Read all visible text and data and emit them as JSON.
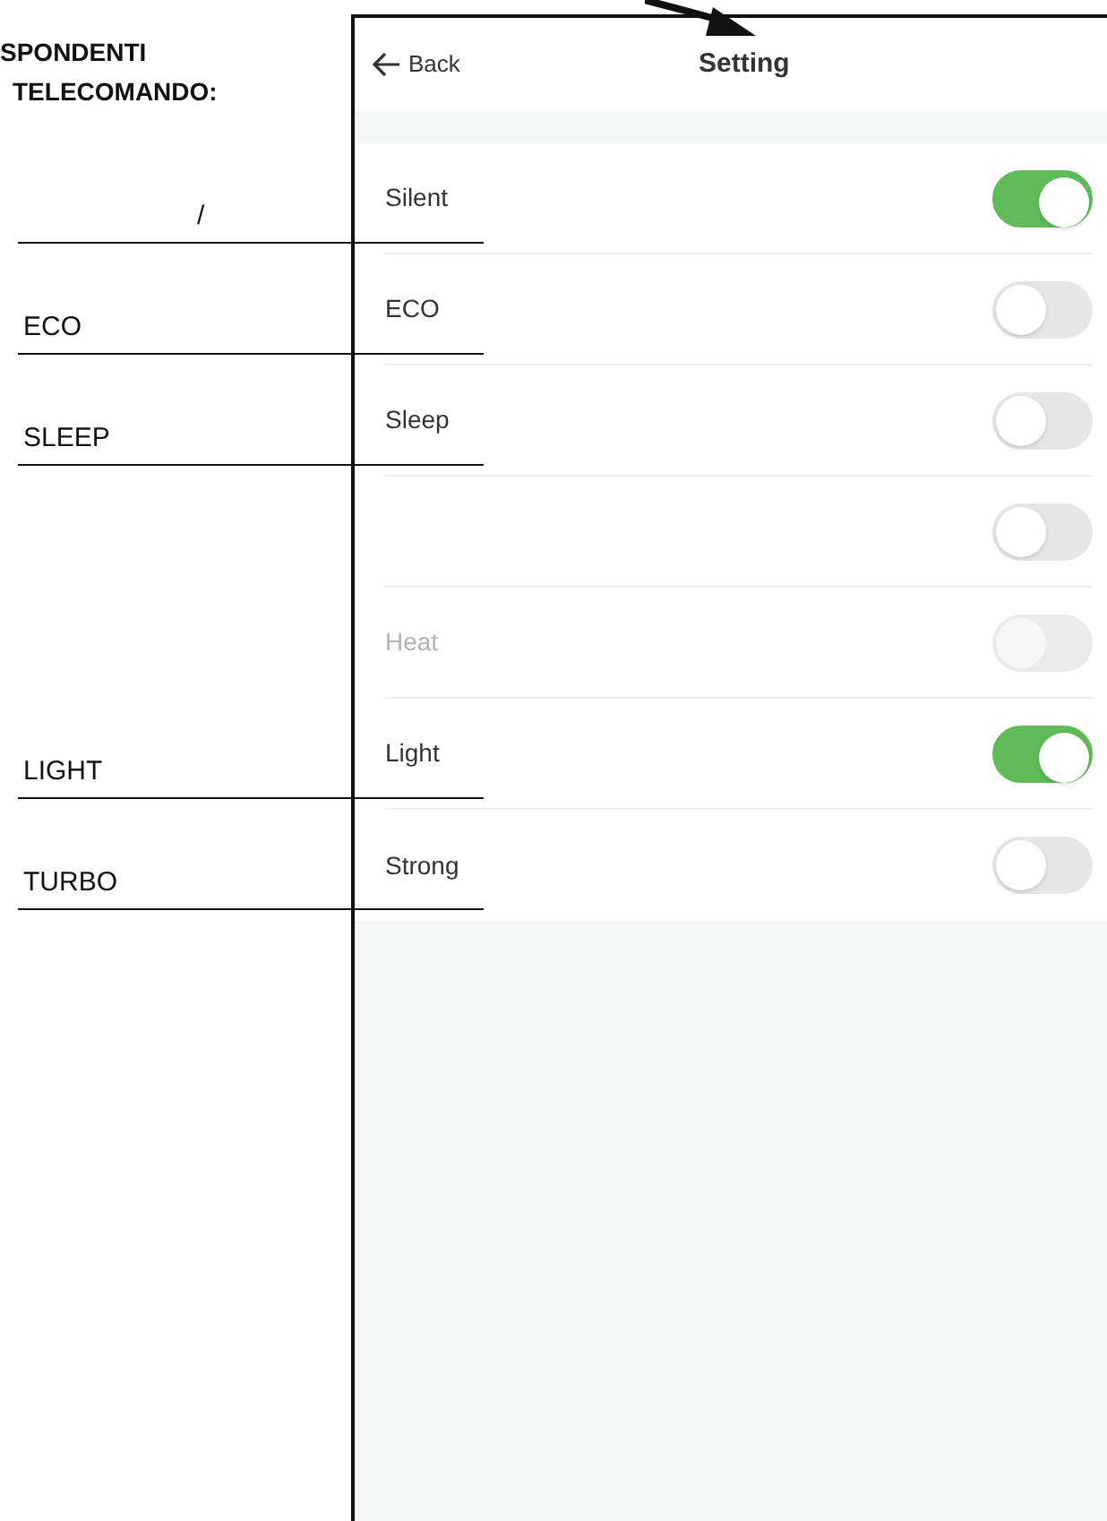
{
  "legend": {
    "heading": [
      "SPONDENTI",
      "TELECOMANDO:"
    ]
  },
  "screen": {
    "back": {
      "label": "Back"
    },
    "title": "Setting",
    "rows": [
      {
        "label": "Silent",
        "on": true,
        "disabled": false,
        "legend": "/"
      },
      {
        "label": "ECO",
        "on": false,
        "disabled": false,
        "legend": "ECO"
      },
      {
        "label": "Sleep",
        "on": false,
        "disabled": false,
        "legend": "SLEEP"
      },
      {
        "on": false,
        "disabled": false
      },
      {
        "label": "Heat",
        "on": false,
        "disabled": true
      },
      {
        "label": "Light",
        "on": true,
        "disabled": false,
        "legend": "LIGHT"
      },
      {
        "label": "Strong",
        "on": false,
        "disabled": false,
        "legend": "TURBO"
      }
    ]
  }
}
